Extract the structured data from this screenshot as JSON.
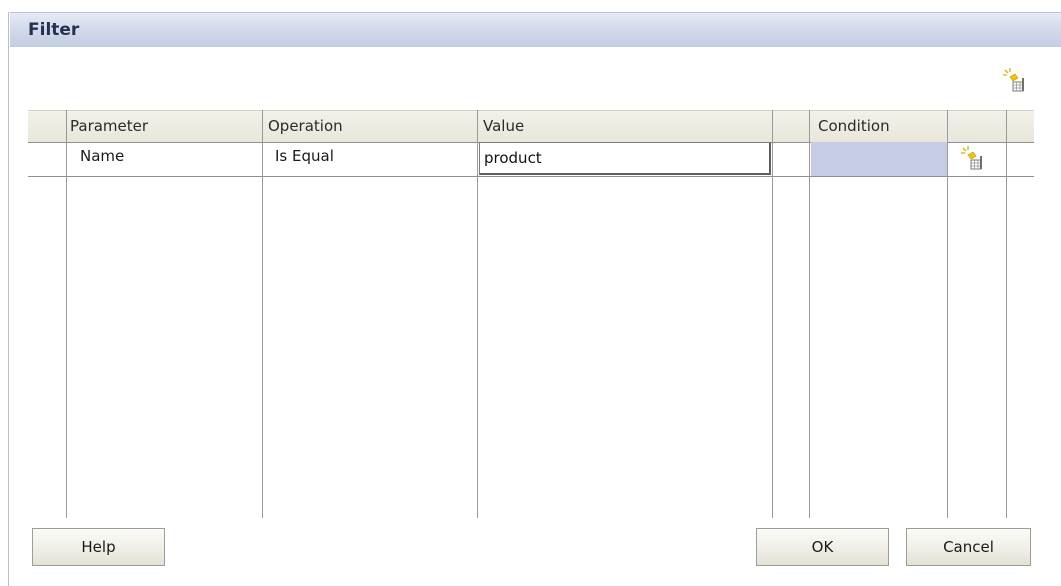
{
  "dialog": {
    "title": "Filter"
  },
  "toolbar": {
    "add_icon": "add-row-icon"
  },
  "grid": {
    "columns": [
      {
        "key": "parameter",
        "label": "Parameter"
      },
      {
        "key": "operation",
        "label": "Operation"
      },
      {
        "key": "value",
        "label": "Value"
      },
      {
        "key": "spacer",
        "label": ""
      },
      {
        "key": "condition",
        "label": "Condition"
      },
      {
        "key": "action",
        "label": ""
      }
    ],
    "rows": [
      {
        "parameter": "Name",
        "operation": "Is Equal",
        "value": "product",
        "condition": "",
        "action_icon": "add-row-icon"
      }
    ]
  },
  "buttons": {
    "help": "Help",
    "ok": "OK",
    "cancel": "Cancel"
  },
  "colors": {
    "title_bar": "#c3cde2",
    "condition_cell": "#c6cbe6",
    "header_bg": "#e9e6da"
  }
}
